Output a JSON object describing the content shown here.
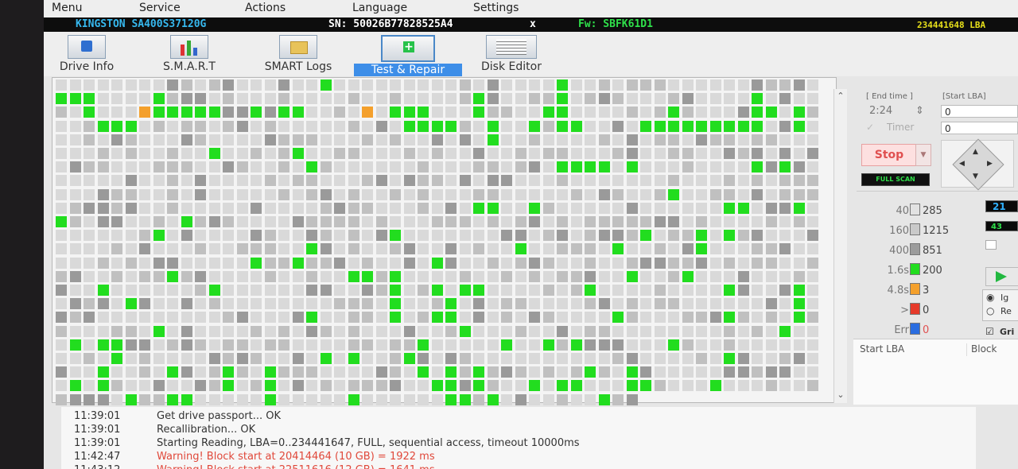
{
  "menu": [
    "Menu",
    "Service",
    "Actions",
    "Language",
    "Settings"
  ],
  "drive": {
    "model": "KINGSTON SA400S37120G",
    "serial": "SN: 50026B77828525A4",
    "close_glyph": "x",
    "firmware": "Fw: SBFK61D1",
    "lba_count": "234441648 LBA"
  },
  "toolbar": [
    {
      "label": "Drive Info"
    },
    {
      "label": "S.M.A.R.T"
    },
    {
      "label": "SMART Logs"
    },
    {
      "label": "Test & Repair",
      "active": true
    },
    {
      "label": "Disk Editor"
    }
  ],
  "scan_map": {
    "grid_on": true,
    "columns": 55,
    "rows": 23,
    "last_row_columns": 42,
    "colors": {
      "light": "#d9d9d9",
      "mid": "#c0c0c0",
      "dark": "#9a9a9a",
      "green": "#22dd1f",
      "orange": "#f4a02c",
      "red": "#e53a2a"
    },
    "green_cells": [
      [
        1,
        0
      ],
      [
        1,
        1
      ],
      [
        1,
        2
      ],
      [
        2,
        2
      ],
      [
        1,
        7
      ],
      [
        2,
        7
      ],
      [
        3,
        3
      ],
      [
        3,
        4
      ],
      [
        3,
        5
      ],
      [
        2,
        6
      ],
      [
        2,
        8
      ],
      [
        2,
        9
      ],
      [
        2,
        10
      ],
      [
        2,
        11
      ],
      [
        2,
        14
      ],
      [
        2,
        16
      ],
      [
        2,
        17
      ],
      [
        2,
        24
      ],
      [
        2,
        25
      ],
      [
        2,
        26
      ],
      [
        3,
        25
      ],
      [
        3,
        26
      ],
      [
        3,
        27
      ],
      [
        3,
        28
      ],
      [
        2,
        30
      ],
      [
        3,
        31
      ],
      [
        1,
        30
      ],
      [
        4,
        31
      ],
      [
        2,
        35
      ],
      [
        3,
        34
      ],
      [
        3,
        36
      ],
      [
        3,
        37
      ],
      [
        2,
        36
      ],
      [
        1,
        36
      ],
      [
        3,
        42
      ],
      [
        3,
        43
      ],
      [
        2,
        44
      ],
      [
        3,
        44
      ],
      [
        3,
        45
      ],
      [
        3,
        46
      ],
      [
        3,
        47
      ],
      [
        3,
        48
      ],
      [
        3,
        49
      ],
      [
        3,
        50
      ],
      [
        2,
        50
      ],
      [
        2,
        51
      ],
      [
        1,
        50
      ],
      [
        2,
        53
      ],
      [
        3,
        53
      ],
      [
        0,
        19
      ],
      [
        0,
        36
      ],
      [
        5,
        11
      ],
      [
        5,
        17
      ],
      [
        6,
        18
      ],
      [
        6,
        36
      ],
      [
        6,
        37
      ],
      [
        6,
        38
      ],
      [
        6,
        39
      ],
      [
        6,
        41
      ],
      [
        6,
        50
      ],
      [
        6,
        52
      ],
      [
        8,
        44
      ],
      [
        9,
        30
      ],
      [
        9,
        31
      ],
      [
        9,
        34
      ],
      [
        9,
        48
      ],
      [
        9,
        49
      ],
      [
        9,
        53
      ],
      [
        10,
        0
      ],
      [
        10,
        9
      ],
      [
        11,
        7
      ],
      [
        11,
        24
      ],
      [
        11,
        42
      ],
      [
        11,
        46
      ],
      [
        11,
        48
      ],
      [
        12,
        18
      ],
      [
        12,
        33
      ],
      [
        12,
        40
      ],
      [
        12,
        46
      ],
      [
        13,
        14
      ],
      [
        13,
        17
      ],
      [
        13,
        27
      ],
      [
        14,
        8
      ],
      [
        14,
        21
      ],
      [
        14,
        22
      ],
      [
        14,
        24
      ],
      [
        14,
        41
      ],
      [
        14,
        45
      ],
      [
        15,
        3
      ],
      [
        15,
        11
      ],
      [
        15,
        24
      ],
      [
        15,
        27
      ],
      [
        15,
        29
      ],
      [
        15,
        30
      ],
      [
        15,
        38
      ],
      [
        15,
        48
      ],
      [
        15,
        53
      ],
      [
        16,
        5
      ],
      [
        16,
        24
      ],
      [
        16,
        28
      ],
      [
        16,
        53
      ],
      [
        17,
        18
      ],
      [
        17,
        24
      ],
      [
        17,
        27
      ],
      [
        17,
        28
      ],
      [
        17,
        40
      ],
      [
        17,
        48
      ],
      [
        17,
        53
      ],
      [
        18,
        7
      ],
      [
        18,
        29
      ],
      [
        18,
        52
      ],
      [
        19,
        1
      ],
      [
        19,
        3
      ],
      [
        19,
        4
      ],
      [
        19,
        26
      ],
      [
        19,
        32
      ],
      [
        19,
        35
      ],
      [
        19,
        37
      ],
      [
        19,
        44
      ],
      [
        20,
        4
      ],
      [
        20,
        19
      ],
      [
        20,
        21
      ],
      [
        20,
        25
      ],
      [
        20,
        48
      ],
      [
        21,
        3
      ],
      [
        21,
        8
      ],
      [
        21,
        12
      ],
      [
        21,
        15
      ],
      [
        21,
        26
      ],
      [
        21,
        28
      ],
      [
        21,
        30
      ],
      [
        21,
        38
      ],
      [
        21,
        41
      ],
      [
        22,
        1
      ],
      [
        22,
        3
      ],
      [
        22,
        12
      ],
      [
        22,
        15
      ],
      [
        22,
        27
      ],
      [
        22,
        28
      ],
      [
        22,
        30
      ],
      [
        22,
        34
      ],
      [
        22,
        36
      ],
      [
        22,
        37
      ],
      [
        22,
        41
      ],
      [
        22,
        42
      ],
      [
        22,
        47
      ],
      [
        23,
        5
      ],
      [
        23,
        8
      ],
      [
        23,
        9
      ],
      [
        23,
        15
      ],
      [
        23,
        21
      ],
      [
        23,
        28
      ],
      [
        23,
        29
      ],
      [
        23,
        31
      ],
      [
        23,
        39
      ]
    ],
    "orange_cells": [
      [
        2,
        6
      ],
      [
        2,
        22
      ]
    ]
  },
  "right_panel": {
    "end_time_label": "[ End time ]",
    "end_time_value": "2:24",
    "start_lba_label": "[Start LBA]",
    "start_lba_value": "0",
    "timer_label": "Timer",
    "timer_value": "0",
    "stop_label": "Stop",
    "mode_label": "FULL SCAN",
    "legend": [
      {
        "label": "40",
        "count": "285",
        "color": "#e2e2e2"
      },
      {
        "label": "160",
        "count": "1215",
        "color": "#c9c9c9"
      },
      {
        "label": "400",
        "count": "851",
        "color": "#9c9c9c"
      },
      {
        "label": "1.6s",
        "count": "200",
        "color": "#22dd1f"
      },
      {
        "label": "4.8s",
        "count": "3",
        "color": "#f4a02c"
      },
      {
        "label": ">",
        "count": "0",
        "color": "#e53a2a"
      },
      {
        "label": "Err",
        "count": "0",
        "color": "#2a6de0"
      }
    ],
    "counter_1": "21",
    "counter_2": "43",
    "radio_1": "Ig",
    "radio_2": "Re",
    "grid_check": "Gri",
    "col_start_lba": "Start LBA",
    "col_block": "Block"
  },
  "log": [
    {
      "time": "11:39:01",
      "message": "Get drive passport... OK",
      "level": "info"
    },
    {
      "time": "11:39:01",
      "message": "Recallibration... OK",
      "level": "info"
    },
    {
      "time": "11:39:01",
      "message": "Starting Reading, LBA=0..234441647, FULL, sequential access, timeout 10000ms",
      "level": "info"
    },
    {
      "time": "11:42:47",
      "message": "Warning! Block start at 20414464 (10 GB)  = 1922 ms",
      "level": "warn"
    },
    {
      "time": "11:43:12",
      "message": "Warning! Block start at 22511616 (12 GB)  = 1641 ms",
      "level": "warn"
    }
  ]
}
